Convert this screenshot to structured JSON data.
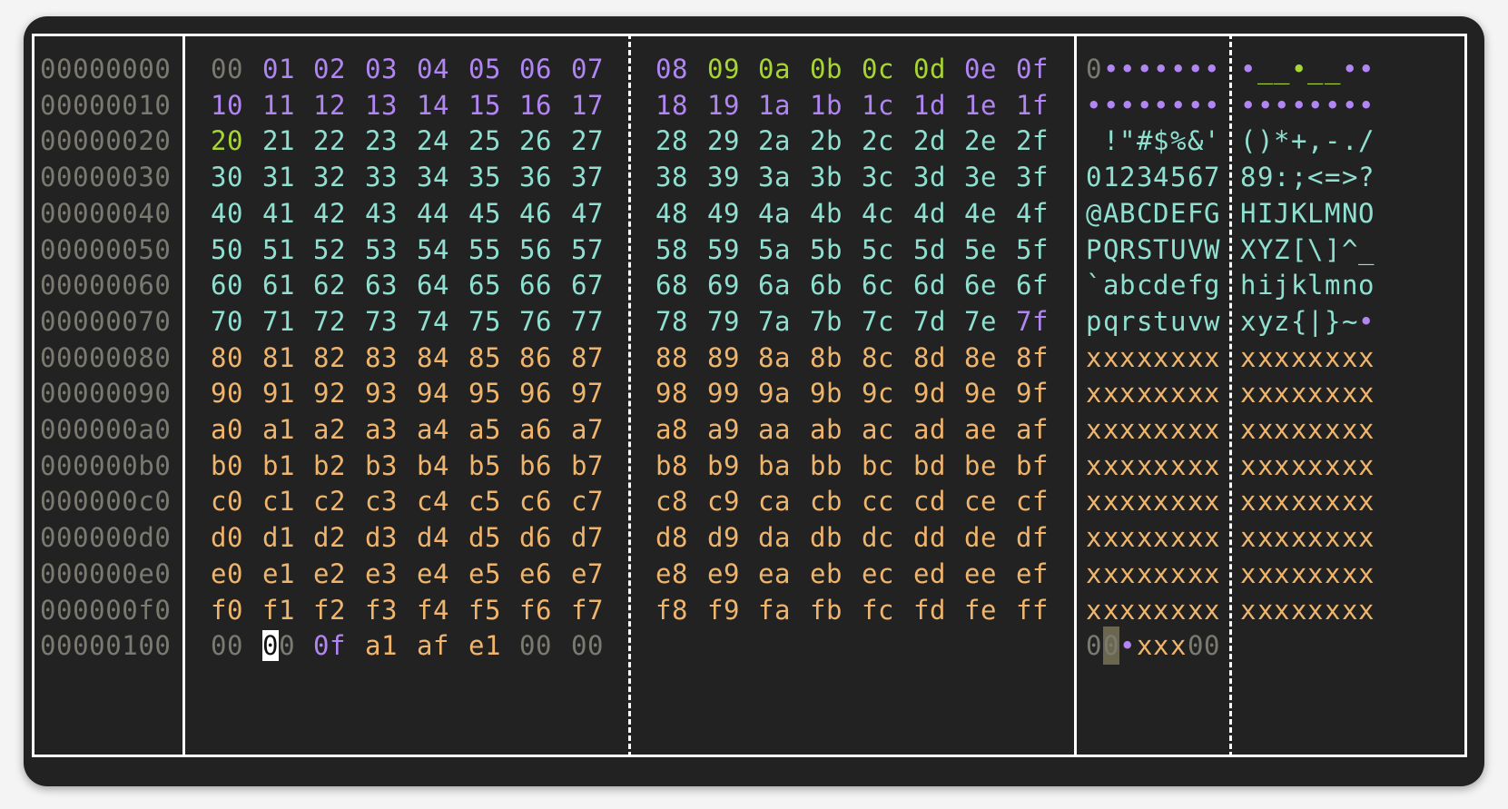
{
  "rows": [
    {
      "offset": "00000000",
      "bytes": [
        "00",
        "01",
        "02",
        "03",
        "04",
        "05",
        "06",
        "07",
        "08",
        "09",
        "0a",
        "0b",
        "0c",
        "0d",
        "0e",
        "0f"
      ],
      "classes": [
        "null",
        "ctrl",
        "ctrl",
        "ctrl",
        "ctrl",
        "ctrl",
        "ctrl",
        "ctrl",
        "ctrl",
        "ws",
        "ws",
        "ws",
        "ws",
        "ws",
        "ctrl",
        "ctrl"
      ],
      "ascii": [
        "0",
        "•",
        "•",
        "•",
        "•",
        "•",
        "•",
        "•",
        "•",
        "_",
        "_",
        "•",
        "_",
        "_",
        "•",
        "•"
      ]
    },
    {
      "offset": "00000010",
      "bytes": [
        "10",
        "11",
        "12",
        "13",
        "14",
        "15",
        "16",
        "17",
        "18",
        "19",
        "1a",
        "1b",
        "1c",
        "1d",
        "1e",
        "1f"
      ],
      "classes": [
        "ctrl",
        "ctrl",
        "ctrl",
        "ctrl",
        "ctrl",
        "ctrl",
        "ctrl",
        "ctrl",
        "ctrl",
        "ctrl",
        "ctrl",
        "ctrl",
        "ctrl",
        "ctrl",
        "ctrl",
        "ctrl"
      ],
      "ascii": [
        "•",
        "•",
        "•",
        "•",
        "•",
        "•",
        "•",
        "•",
        "•",
        "•",
        "•",
        "•",
        "•",
        "•",
        "•",
        "•"
      ]
    },
    {
      "offset": "00000020",
      "bytes": [
        "20",
        "21",
        "22",
        "23",
        "24",
        "25",
        "26",
        "27",
        "28",
        "29",
        "2a",
        "2b",
        "2c",
        "2d",
        "2e",
        "2f"
      ],
      "classes": [
        "ws",
        "print",
        "print",
        "print",
        "print",
        "print",
        "print",
        "print",
        "print",
        "print",
        "print",
        "print",
        "print",
        "print",
        "print",
        "print"
      ],
      "ascii": [
        " ",
        "!",
        "\"",
        "#",
        "$",
        "%",
        "&",
        "'",
        "(",
        ")",
        "*",
        "+",
        ",",
        "-",
        ".",
        "/"
      ]
    },
    {
      "offset": "00000030",
      "bytes": [
        "30",
        "31",
        "32",
        "33",
        "34",
        "35",
        "36",
        "37",
        "38",
        "39",
        "3a",
        "3b",
        "3c",
        "3d",
        "3e",
        "3f"
      ],
      "classes": [
        "print",
        "print",
        "print",
        "print",
        "print",
        "print",
        "print",
        "print",
        "print",
        "print",
        "print",
        "print",
        "print",
        "print",
        "print",
        "print"
      ],
      "ascii": [
        "0",
        "1",
        "2",
        "3",
        "4",
        "5",
        "6",
        "7",
        "8",
        "9",
        ":",
        ";",
        "<",
        "=",
        ">",
        "?"
      ]
    },
    {
      "offset": "00000040",
      "bytes": [
        "40",
        "41",
        "42",
        "43",
        "44",
        "45",
        "46",
        "47",
        "48",
        "49",
        "4a",
        "4b",
        "4c",
        "4d",
        "4e",
        "4f"
      ],
      "classes": [
        "print",
        "print",
        "print",
        "print",
        "print",
        "print",
        "print",
        "print",
        "print",
        "print",
        "print",
        "print",
        "print",
        "print",
        "print",
        "print"
      ],
      "ascii": [
        "@",
        "A",
        "B",
        "C",
        "D",
        "E",
        "F",
        "G",
        "H",
        "I",
        "J",
        "K",
        "L",
        "M",
        "N",
        "O"
      ]
    },
    {
      "offset": "00000050",
      "bytes": [
        "50",
        "51",
        "52",
        "53",
        "54",
        "55",
        "56",
        "57",
        "58",
        "59",
        "5a",
        "5b",
        "5c",
        "5d",
        "5e",
        "5f"
      ],
      "classes": [
        "print",
        "print",
        "print",
        "print",
        "print",
        "print",
        "print",
        "print",
        "print",
        "print",
        "print",
        "print",
        "print",
        "print",
        "print",
        "print"
      ],
      "ascii": [
        "P",
        "Q",
        "R",
        "S",
        "T",
        "U",
        "V",
        "W",
        "X",
        "Y",
        "Z",
        "[",
        "\\",
        "]",
        "^",
        "_"
      ]
    },
    {
      "offset": "00000060",
      "bytes": [
        "60",
        "61",
        "62",
        "63",
        "64",
        "65",
        "66",
        "67",
        "68",
        "69",
        "6a",
        "6b",
        "6c",
        "6d",
        "6e",
        "6f"
      ],
      "classes": [
        "print",
        "print",
        "print",
        "print",
        "print",
        "print",
        "print",
        "print",
        "print",
        "print",
        "print",
        "print",
        "print",
        "print",
        "print",
        "print"
      ],
      "ascii": [
        "`",
        "a",
        "b",
        "c",
        "d",
        "e",
        "f",
        "g",
        "h",
        "i",
        "j",
        "k",
        "l",
        "m",
        "n",
        "o"
      ]
    },
    {
      "offset": "00000070",
      "bytes": [
        "70",
        "71",
        "72",
        "73",
        "74",
        "75",
        "76",
        "77",
        "78",
        "79",
        "7a",
        "7b",
        "7c",
        "7d",
        "7e",
        "7f"
      ],
      "classes": [
        "print",
        "print",
        "print",
        "print",
        "print",
        "print",
        "print",
        "print",
        "print",
        "print",
        "print",
        "print",
        "print",
        "print",
        "print",
        "ctrl"
      ],
      "ascii": [
        "p",
        "q",
        "r",
        "s",
        "t",
        "u",
        "v",
        "w",
        "x",
        "y",
        "z",
        "{",
        "|",
        "}",
        "~",
        "•"
      ]
    },
    {
      "offset": "00000080",
      "bytes": [
        "80",
        "81",
        "82",
        "83",
        "84",
        "85",
        "86",
        "87",
        "88",
        "89",
        "8a",
        "8b",
        "8c",
        "8d",
        "8e",
        "8f"
      ],
      "classes": [
        "high",
        "high",
        "high",
        "high",
        "high",
        "high",
        "high",
        "high",
        "high",
        "high",
        "high",
        "high",
        "high",
        "high",
        "high",
        "high"
      ],
      "ascii": [
        "x",
        "x",
        "x",
        "x",
        "x",
        "x",
        "x",
        "x",
        "x",
        "x",
        "x",
        "x",
        "x",
        "x",
        "x",
        "x"
      ]
    },
    {
      "offset": "00000090",
      "bytes": [
        "90",
        "91",
        "92",
        "93",
        "94",
        "95",
        "96",
        "97",
        "98",
        "99",
        "9a",
        "9b",
        "9c",
        "9d",
        "9e",
        "9f"
      ],
      "classes": [
        "high",
        "high",
        "high",
        "high",
        "high",
        "high",
        "high",
        "high",
        "high",
        "high",
        "high",
        "high",
        "high",
        "high",
        "high",
        "high"
      ],
      "ascii": [
        "x",
        "x",
        "x",
        "x",
        "x",
        "x",
        "x",
        "x",
        "x",
        "x",
        "x",
        "x",
        "x",
        "x",
        "x",
        "x"
      ]
    },
    {
      "offset": "000000a0",
      "bytes": [
        "a0",
        "a1",
        "a2",
        "a3",
        "a4",
        "a5",
        "a6",
        "a7",
        "a8",
        "a9",
        "aa",
        "ab",
        "ac",
        "ad",
        "ae",
        "af"
      ],
      "classes": [
        "high",
        "high",
        "high",
        "high",
        "high",
        "high",
        "high",
        "high",
        "high",
        "high",
        "high",
        "high",
        "high",
        "high",
        "high",
        "high"
      ],
      "ascii": [
        "x",
        "x",
        "x",
        "x",
        "x",
        "x",
        "x",
        "x",
        "x",
        "x",
        "x",
        "x",
        "x",
        "x",
        "x",
        "x"
      ]
    },
    {
      "offset": "000000b0",
      "bytes": [
        "b0",
        "b1",
        "b2",
        "b3",
        "b4",
        "b5",
        "b6",
        "b7",
        "b8",
        "b9",
        "ba",
        "bb",
        "bc",
        "bd",
        "be",
        "bf"
      ],
      "classes": [
        "high",
        "high",
        "high",
        "high",
        "high",
        "high",
        "high",
        "high",
        "high",
        "high",
        "high",
        "high",
        "high",
        "high",
        "high",
        "high"
      ],
      "ascii": [
        "x",
        "x",
        "x",
        "x",
        "x",
        "x",
        "x",
        "x",
        "x",
        "x",
        "x",
        "x",
        "x",
        "x",
        "x",
        "x"
      ]
    },
    {
      "offset": "000000c0",
      "bytes": [
        "c0",
        "c1",
        "c2",
        "c3",
        "c4",
        "c5",
        "c6",
        "c7",
        "c8",
        "c9",
        "ca",
        "cb",
        "cc",
        "cd",
        "ce",
        "cf"
      ],
      "classes": [
        "high",
        "high",
        "high",
        "high",
        "high",
        "high",
        "high",
        "high",
        "high",
        "high",
        "high",
        "high",
        "high",
        "high",
        "high",
        "high"
      ],
      "ascii": [
        "x",
        "x",
        "x",
        "x",
        "x",
        "x",
        "x",
        "x",
        "x",
        "x",
        "x",
        "x",
        "x",
        "x",
        "x",
        "x"
      ]
    },
    {
      "offset": "000000d0",
      "bytes": [
        "d0",
        "d1",
        "d2",
        "d3",
        "d4",
        "d5",
        "d6",
        "d7",
        "d8",
        "d9",
        "da",
        "db",
        "dc",
        "dd",
        "de",
        "df"
      ],
      "classes": [
        "high",
        "high",
        "high",
        "high",
        "high",
        "high",
        "high",
        "high",
        "high",
        "high",
        "high",
        "high",
        "high",
        "high",
        "high",
        "high"
      ],
      "ascii": [
        "x",
        "x",
        "x",
        "x",
        "x",
        "x",
        "x",
        "x",
        "x",
        "x",
        "x",
        "x",
        "x",
        "x",
        "x",
        "x"
      ]
    },
    {
      "offset": "000000e0",
      "bytes": [
        "e0",
        "e1",
        "e2",
        "e3",
        "e4",
        "e5",
        "e6",
        "e7",
        "e8",
        "e9",
        "ea",
        "eb",
        "ec",
        "ed",
        "ee",
        "ef"
      ],
      "classes": [
        "high",
        "high",
        "high",
        "high",
        "high",
        "high",
        "high",
        "high",
        "high",
        "high",
        "high",
        "high",
        "high",
        "high",
        "high",
        "high"
      ],
      "ascii": [
        "x",
        "x",
        "x",
        "x",
        "x",
        "x",
        "x",
        "x",
        "x",
        "x",
        "x",
        "x",
        "x",
        "x",
        "x",
        "x"
      ]
    },
    {
      "offset": "000000f0",
      "bytes": [
        "f0",
        "f1",
        "f2",
        "f3",
        "f4",
        "f5",
        "f6",
        "f7",
        "f8",
        "f9",
        "fa",
        "fb",
        "fc",
        "fd",
        "fe",
        "ff"
      ],
      "classes": [
        "high",
        "high",
        "high",
        "high",
        "high",
        "high",
        "high",
        "high",
        "high",
        "high",
        "high",
        "high",
        "high",
        "high",
        "high",
        "high"
      ],
      "ascii": [
        "x",
        "x",
        "x",
        "x",
        "x",
        "x",
        "x",
        "x",
        "x",
        "x",
        "x",
        "x",
        "x",
        "x",
        "x",
        "x"
      ]
    },
    {
      "offset": "00000100",
      "bytes": [
        "00",
        "00",
        "0f",
        "a1",
        "af",
        "e1",
        "00",
        "00"
      ],
      "classes": [
        "null",
        "null",
        "ctrl",
        "high",
        "high",
        "high",
        "null",
        "null"
      ],
      "ascii": [
        "0",
        "0",
        "•",
        "x",
        "x",
        "x",
        "0",
        "0"
      ]
    }
  ],
  "cursor": {
    "row": 16,
    "col": 1
  },
  "colors": {
    "background": "#222222",
    "offset": "#7b7a71",
    "null": "#7b7a71",
    "control": "#b185f2",
    "whitespace": "#a6d534",
    "printable": "#8fe0d0",
    "non_ascii": "#f0b56d",
    "cursor": "#ffffff"
  }
}
